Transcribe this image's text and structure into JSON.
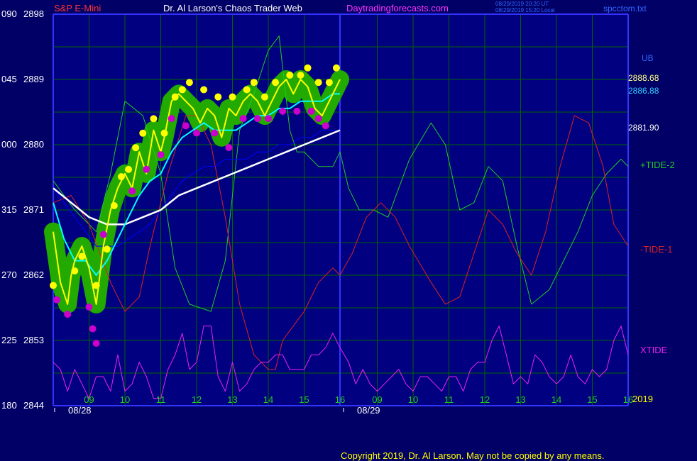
{
  "header": {
    "symbol": "S&P E-Mini",
    "title": "Dr. Al Larson's Chaos Trader Web",
    "site": "Daytradingforecasts.com",
    "time_utc": "08/29/2019 20:20 UT",
    "time_local": "08/29/2019 15:20 Local",
    "file": "spcctom.txt"
  },
  "footer": {
    "copyright": "Copyright 2019, Dr. Al Larson. May not be copied by any means."
  },
  "year": "2019",
  "colors": {
    "background": "#000066",
    "plot_bg": "#000080",
    "grid": "#006600",
    "axis": "#3333ff",
    "price": "#ffff00",
    "ema_fast": "#00ffff",
    "ema_slow": "#ffffff",
    "ema_mid": "#0000ff",
    "tide_plus": "#22cc22",
    "tide_minus": "#dd2222",
    "xtide": "#ee22ee",
    "highlight": "#22aa00",
    "peak_dot": "#ffff00",
    "trough_dot": "#cc00cc"
  },
  "chart_data": {
    "type": "line",
    "title": "Dr. Al Larson's Chaos Trader Web",
    "xlabel": "",
    "ylabel": "",
    "ylim": [
      2844,
      2898
    ],
    "grid": true,
    "y_left_ticks": [
      {
        "tide": "180",
        "price": "2844"
      },
      {
        "tide": "225",
        "price": "2853"
      },
      {
        "tide": "270",
        "price": "2862"
      },
      {
        "tide": "315",
        "price": "2871"
      },
      {
        "tide": "000",
        "price": "2880"
      },
      {
        "tide": "045",
        "price": "2889"
      },
      {
        "tide": "090",
        "price": "2898"
      }
    ],
    "x_hour_ticks": [
      "09",
      "10",
      "11",
      "12",
      "13",
      "14",
      "15",
      "16",
      "09",
      "10",
      "11",
      "12",
      "13",
      "14",
      "15",
      "16"
    ],
    "x_dates": [
      "08/28",
      "08/29"
    ],
    "price_labels": [
      {
        "text": "UB",
        "value": 2890.7
      },
      {
        "text": "2888.68",
        "value": 2888.68
      },
      {
        "text": "2886.88",
        "value": 2886.88
      },
      {
        "text": "2881.90",
        "value": 2881.9
      }
    ],
    "series": [
      {
        "name": "+TIDE-2",
        "x": [
          8.0,
          8.6,
          9.2,
          9.6,
          10.0,
          10.5,
          11.0,
          11.4,
          11.8,
          12.4,
          12.8,
          13.2,
          13.6,
          14.0,
          14.3,
          14.6,
          14.8,
          15.0,
          15.4,
          15.8,
          16.0,
          16.2,
          16.5,
          16.9,
          17.3,
          17.9,
          18.5,
          18.9,
          19.3,
          19.7,
          20.1,
          20.5,
          20.9,
          21.3,
          21.8,
          22.2,
          22.6,
          23.0,
          23.4,
          23.8,
          24.0
        ],
        "y": [
          2875,
          2871,
          2868,
          2876,
          2886,
          2884,
          2876,
          2863,
          2858,
          2857,
          2864,
          2882,
          2887,
          2893,
          2895,
          2882,
          2879,
          2879,
          2877,
          2877,
          2879,
          2874,
          2871,
          2871,
          2870,
          2878,
          2883,
          2880,
          2871,
          2872,
          2877,
          2875,
          2866,
          2858,
          2860,
          2864,
          2868,
          2873,
          2876,
          2878,
          2877
        ]
      },
      {
        "name": "-TIDE-1",
        "x": [
          8.0,
          8.5,
          9.0,
          9.3,
          9.6,
          10.0,
          10.4,
          10.7,
          11.2,
          11.7,
          12.0,
          12.4,
          12.8,
          13.2,
          13.6,
          14.0,
          14.2,
          14.4,
          14.7,
          15.0,
          15.4,
          15.8,
          16.0,
          16.3,
          16.7,
          17.1,
          17.5,
          17.9,
          18.5,
          18.9,
          19.3,
          19.7,
          20.1,
          20.5,
          20.9,
          21.3,
          21.7,
          22.1,
          22.5,
          22.9,
          23.3,
          23.6,
          24.0
        ],
        "y": [
          2872,
          2873,
          2869,
          2865,
          2861,
          2857,
          2859,
          2866,
          2876,
          2884,
          2884,
          2880,
          2870,
          2858,
          2851,
          2849,
          2849,
          2853,
          2855,
          2857,
          2861,
          2863,
          2862,
          2865,
          2870,
          2872,
          2870,
          2866,
          2861,
          2858,
          2859,
          2865,
          2871,
          2869,
          2865,
          2862,
          2868,
          2877,
          2884,
          2883,
          2877,
          2869,
          2866
        ]
      },
      {
        "name": "XTIDE",
        "x": [
          8.0,
          8.2,
          8.4,
          8.6,
          8.8,
          9.0,
          9.2,
          9.4,
          9.6,
          9.8,
          10.0,
          10.2,
          10.4,
          10.6,
          10.8,
          11.0,
          11.2,
          11.4,
          11.6,
          11.8,
          12.0,
          12.2,
          12.4,
          12.6,
          12.8,
          13.0,
          13.2,
          13.4,
          13.6,
          13.8,
          14.0,
          14.2,
          14.4,
          14.6,
          14.8,
          15.0,
          15.2,
          15.4,
          15.6,
          15.8,
          16.0,
          16.2,
          16.4,
          16.6,
          16.8,
          17.0,
          17.2,
          17.4,
          17.6,
          17.8,
          18.0,
          18.2,
          18.4,
          18.6,
          18.8,
          19.0,
          19.2,
          19.4,
          19.6,
          19.8,
          20.0,
          20.2,
          20.4,
          20.6,
          20.8,
          21.0,
          21.2,
          21.4,
          21.6,
          21.8,
          22.0,
          22.2,
          22.4,
          22.6,
          22.8,
          23.0,
          23.2,
          23.4,
          23.6,
          23.8,
          24.0
        ],
        "y": [
          2850,
          2849,
          2846,
          2849,
          2847,
          2845,
          2848,
          2848,
          2846,
          2851,
          2846,
          2847,
          2850,
          2848,
          2845,
          2845,
          2849,
          2851,
          2854,
          2849,
          2850,
          2855,
          2855,
          2848,
          2846,
          2850,
          2846,
          2847,
          2849,
          2850,
          2850,
          2851,
          2851,
          2849,
          2849,
          2849,
          2851,
          2851,
          2852,
          2854,
          2852,
          2850,
          2847,
          2849,
          2847,
          2846,
          2847,
          2848,
          2849,
          2847,
          2846,
          2848,
          2848,
          2847,
          2846,
          2848,
          2848,
          2846,
          2849,
          2850,
          2850,
          2853,
          2855,
          2851,
          2847,
          2848,
          2847,
          2851,
          2850,
          2848,
          2847,
          2848,
          2851,
          2848,
          2847,
          2849,
          2848,
          2849,
          2853,
          2855,
          2851
        ]
      },
      {
        "name": "price",
        "x": [
          8.0,
          8.2,
          8.4,
          8.5,
          8.6,
          8.8,
          9.0,
          9.2,
          9.4,
          9.6,
          9.8,
          10.0,
          10.2,
          10.4,
          10.6,
          10.8,
          11.0,
          11.1,
          11.3,
          11.5,
          11.7,
          11.9,
          12.1,
          12.3,
          12.5,
          12.7,
          12.9,
          13.1,
          13.3,
          13.5,
          13.7,
          13.9,
          14.1,
          14.3,
          14.5,
          14.7,
          14.9,
          15.1,
          15.3,
          15.5,
          15.7,
          15.9,
          16.0
        ],
        "y": [
          2868,
          2861,
          2858,
          2862,
          2864,
          2866,
          2863,
          2858,
          2866,
          2871,
          2874,
          2876,
          2874,
          2879,
          2876,
          2882,
          2879,
          2881,
          2886,
          2887,
          2886,
          2885,
          2883,
          2885,
          2884,
          2881,
          2885,
          2884,
          2886,
          2887,
          2886,
          2884,
          2886,
          2888,
          2889,
          2887,
          2889,
          2888,
          2885,
          2884,
          2886,
          2888,
          2889
        ]
      },
      {
        "name": "ema_fast",
        "x": [
          8.0,
          8.3,
          8.6,
          8.9,
          9.2,
          9.5,
          9.8,
          10.1,
          10.4,
          10.7,
          11.0,
          11.3,
          11.6,
          11.9,
          12.2,
          12.5,
          12.8,
          13.1,
          13.4,
          13.7,
          14.0,
          14.3,
          14.6,
          14.9,
          15.2,
          15.5,
          15.8,
          16.0
        ],
        "y": [
          2872,
          2867,
          2864,
          2864,
          2862,
          2864,
          2867,
          2870,
          2873,
          2875,
          2876,
          2879,
          2881,
          2882,
          2883,
          2882,
          2882,
          2882,
          2883,
          2884,
          2884,
          2885,
          2885,
          2886,
          2886,
          2886,
          2887,
          2887
        ]
      },
      {
        "name": "ema_mid",
        "x": [
          8.0,
          8.3,
          8.6,
          8.9,
          9.2,
          9.5,
          9.8,
          10.1,
          10.4,
          10.7,
          11.0,
          11.3,
          11.6,
          11.9,
          12.2,
          12.5,
          12.8,
          13.1,
          13.4,
          13.7,
          14.0,
          14.3,
          14.6,
          14.9,
          15.2,
          15.5,
          15.8,
          16.0
        ],
        "y": [
          2874,
          2872,
          2870,
          2868,
          2866,
          2866,
          2866,
          2867,
          2868,
          2869,
          2871,
          2873,
          2875,
          2876,
          2877,
          2877,
          2878,
          2878,
          2878,
          2879,
          2879,
          2880,
          2880,
          2881,
          2881,
          2882,
          2882,
          2882
        ]
      },
      {
        "name": "ema_slow",
        "x": [
          8.0,
          8.5,
          9.0,
          9.5,
          10.0,
          10.5,
          11.0,
          11.5,
          12.0,
          12.5,
          13.0,
          13.5,
          14.0,
          14.5,
          15.0,
          15.5,
          16.0
        ],
        "y": [
          2874,
          2872,
          2870,
          2869,
          2869,
          2870,
          2871,
          2873,
          2874,
          2875,
          2876,
          2877,
          2878,
          2879,
          2880,
          2881,
          2882
        ]
      }
    ],
    "peak_dots": [
      [
        8.0,
        2860
      ],
      [
        8.6,
        2862
      ],
      [
        8.8,
        2864
      ],
      [
        9.2,
        2860
      ],
      [
        9.5,
        2865
      ],
      [
        9.7,
        2871
      ],
      [
        9.9,
        2875
      ],
      [
        10.1,
        2876
      ],
      [
        10.3,
        2879
      ],
      [
        10.5,
        2881
      ],
      [
        10.8,
        2883
      ],
      [
        11.1,
        2881
      ],
      [
        11.4,
        2886
      ],
      [
        11.6,
        2887
      ],
      [
        11.8,
        2888
      ],
      [
        12.2,
        2887
      ],
      [
        12.6,
        2886
      ],
      [
        13.0,
        2886
      ],
      [
        13.4,
        2887
      ],
      [
        13.6,
        2888
      ],
      [
        13.9,
        2886
      ],
      [
        14.2,
        2888
      ],
      [
        14.6,
        2889
      ],
      [
        14.9,
        2889
      ],
      [
        15.1,
        2890
      ],
      [
        15.4,
        2888
      ],
      [
        15.7,
        2888
      ],
      [
        15.9,
        2890
      ]
    ],
    "trough_dots": [
      [
        8.1,
        2859
      ],
      [
        8.4,
        2857
      ],
      [
        9.0,
        2858
      ],
      [
        9.1,
        2855
      ],
      [
        9.2,
        2853
      ],
      [
        9.4,
        2868
      ],
      [
        10.2,
        2874
      ],
      [
        10.6,
        2877
      ],
      [
        11.0,
        2879
      ],
      [
        11.3,
        2884
      ],
      [
        11.7,
        2883
      ],
      [
        12.0,
        2882
      ],
      [
        12.5,
        2882
      ],
      [
        12.9,
        2880
      ],
      [
        13.3,
        2884
      ],
      [
        13.7,
        2884
      ],
      [
        14.0,
        2884
      ],
      [
        14.4,
        2885
      ],
      [
        14.8,
        2885
      ],
      [
        15.2,
        2885
      ],
      [
        15.4,
        2884
      ],
      [
        15.6,
        2883
      ]
    ]
  }
}
